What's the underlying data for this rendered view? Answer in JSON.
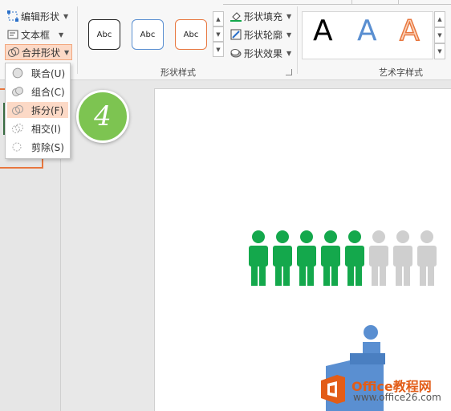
{
  "ribbon": {
    "edit_shape": "编辑形状",
    "text_box": "文本框",
    "merge_shapes": "合并形状",
    "shape_styles_label": "形状样式",
    "wordart_label": "艺术字样式",
    "style_samples": [
      "Abc",
      "Abc",
      "Abc"
    ],
    "shape_fill": "形状填充",
    "shape_outline": "形状轮廓",
    "shape_effects": "形状效果",
    "wordart_samples": [
      "A",
      "A",
      "A"
    ]
  },
  "merge_menu": {
    "items": [
      {
        "label": "联合(U)",
        "icon": "union-icon"
      },
      {
        "label": "组合(C)",
        "icon": "combine-icon"
      },
      {
        "label": "拆分(F)",
        "icon": "fragment-icon"
      },
      {
        "label": "相交(I)",
        "icon": "intersect-icon"
      },
      {
        "label": "剪除(S)",
        "icon": "subtract-icon"
      }
    ],
    "highlighted_index": 2
  },
  "step_badge": "4",
  "slide": {
    "people_green_count": 5,
    "people_gray_count": 3,
    "colors": {
      "green": "#14a84c",
      "gray": "#cfcfcf",
      "blue": "#5a8fd1"
    }
  },
  "watermark": {
    "title": "Office教程网",
    "url": "www.office26.com"
  },
  "colors": {
    "accent": "#e8773f",
    "highlight": "#fcd9c6",
    "badge": "#7dc451"
  }
}
